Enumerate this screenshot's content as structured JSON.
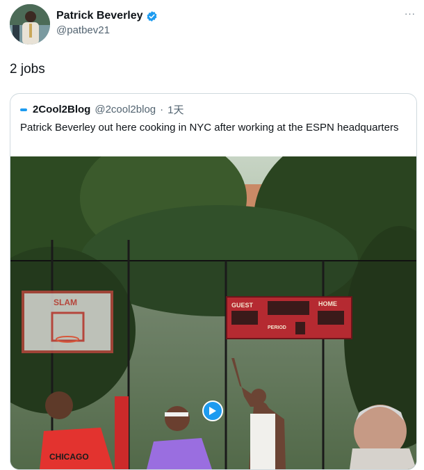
{
  "author": {
    "name": "Patrick Beverley",
    "handle": "@patbev21",
    "verified": true,
    "avatar_icon": "avatar-photo"
  },
  "more_icon": "ellipsis-icon",
  "tweet": {
    "text": "2 jobs"
  },
  "quoted": {
    "name": "2Cool2Blog",
    "handle": "@2cool2blog",
    "separator": "·",
    "time": "1天",
    "text": "Patrick Beverley out here cooking in NYC after working at the ESPN headquarters",
    "media": {
      "type": "video",
      "scoreboard": {
        "guest_label": "GUEST",
        "home_label": "HOME",
        "period_label": "PERIOD"
      },
      "shirt_text": "CHICAGO",
      "play_icon": "play-icon"
    }
  },
  "colors": {
    "accent": "#1d9bf0",
    "text": "#0f1419",
    "secondary": "#536471",
    "border": "#cfd9de"
  }
}
